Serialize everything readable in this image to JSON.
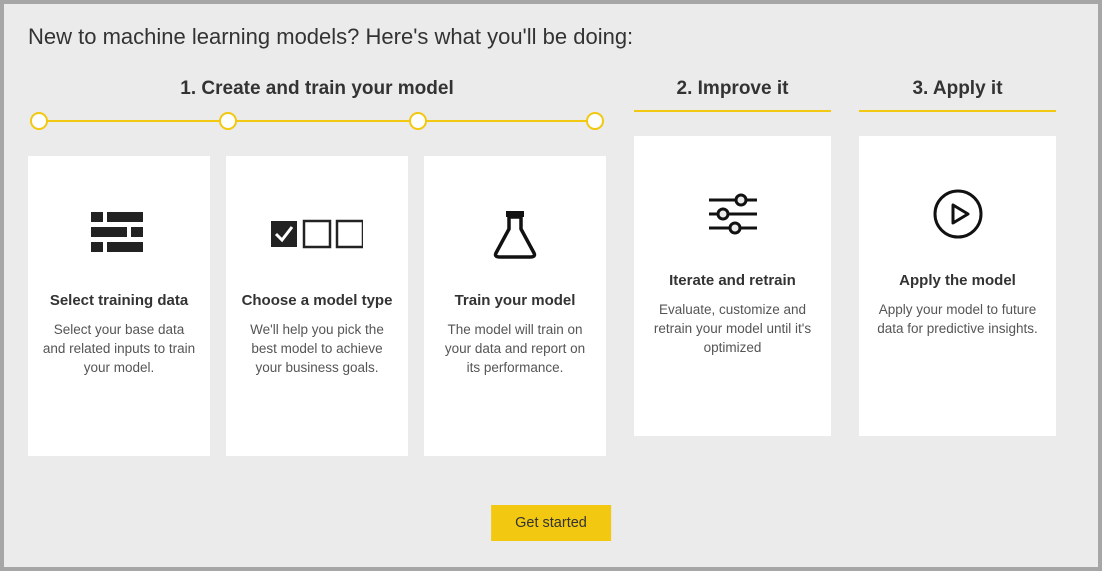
{
  "intro": "New to machine learning models? Here's what you'll be doing:",
  "phases": {
    "p1": {
      "title": "1. Create and train your model"
    },
    "p2": {
      "title": "2. Improve it"
    },
    "p3": {
      "title": "3. Apply it"
    }
  },
  "cards": {
    "c1": {
      "title": "Select training data",
      "desc": "Select your base data and related inputs to train your model."
    },
    "c2": {
      "title": "Choose a model type",
      "desc": "We'll help you pick the best model to achieve your business goals."
    },
    "c3": {
      "title": "Train your model",
      "desc": "The model will train on your data and report on its performance."
    },
    "c4": {
      "title": "Iterate and retrain",
      "desc": "Evaluate, customize and retrain your model until it's optimized"
    },
    "c5": {
      "title": "Apply the model",
      "desc": "Apply your model to future data for predictive insights."
    }
  },
  "button": {
    "get_started": "Get started"
  },
  "colors": {
    "accent": "#f2c811"
  }
}
